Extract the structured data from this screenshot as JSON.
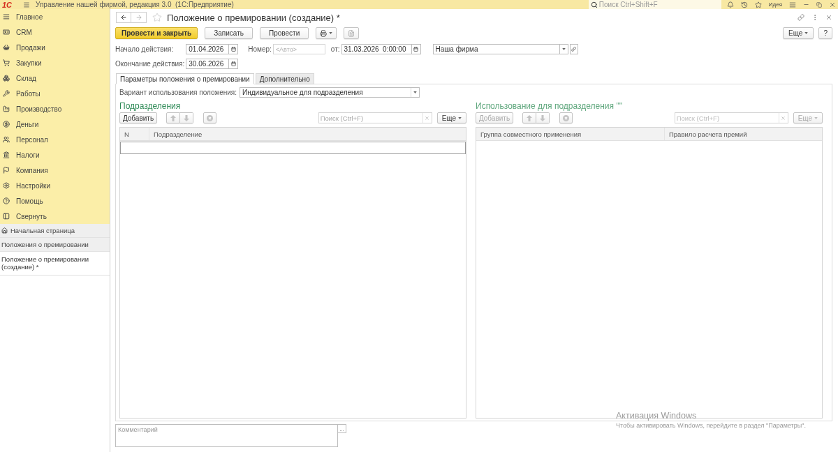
{
  "app_bar": {
    "logo": "1С",
    "title": "Управление нашей фирмой, редакция 3.0  (1С:Предприятие)",
    "search": {
      "placeholder": "Поиск Ctrl+Shift+F"
    },
    "idea": "Идея"
  },
  "sidebar": {
    "sections": [
      {
        "label": "Главное"
      },
      {
        "label": "CRM"
      },
      {
        "label": "Продажи"
      },
      {
        "label": "Закупки"
      },
      {
        "label": "Склад"
      },
      {
        "label": "Работы"
      },
      {
        "label": "Производство"
      },
      {
        "label": "Деньги"
      },
      {
        "label": "Персонал"
      },
      {
        "label": "Налоги"
      },
      {
        "label": "Компания"
      },
      {
        "label": "Настройки"
      },
      {
        "label": "Помощь"
      },
      {
        "label": "Свернуть"
      }
    ],
    "open_windows": [
      {
        "label": "Начальная страница",
        "kind": "home",
        "selected": false
      },
      {
        "label": "Положения о премировании",
        "kind": "window",
        "selected": false
      },
      {
        "label": "Положение о премировании (создание) *",
        "kind": "window",
        "selected": true
      }
    ]
  },
  "form": {
    "title": "Положение о премировании (создание) *",
    "starred": false,
    "toolbar": [
      {
        "kind": "primary",
        "label": "Провести и закрыть"
      },
      {
        "kind": "plain",
        "label": "Записать"
      },
      {
        "kind": "plain",
        "label": "Провести"
      },
      {
        "kind": "print"
      },
      {
        "kind": "report"
      }
    ],
    "more": "Еще",
    "help": "?",
    "start": {
      "label": "Начало действия:",
      "value": "01.04.2026"
    },
    "number": {
      "label": "Номер:",
      "placeholder": "<Авто>"
    },
    "date": {
      "label": "от:",
      "value": "31.03.2026  0:00:00"
    },
    "organization": {
      "value": "Наша фирма"
    },
    "end": {
      "label": "Окончание действия:",
      "value": "30.06.2026"
    },
    "tabs": [
      {
        "label": "Параметры положения о премировании",
        "selected": true
      },
      {
        "label": "Дополнительно",
        "selected": false
      }
    ],
    "usage_variant": {
      "label": "Вариант использования положения:",
      "value": "Индивидуальное для подразделения"
    },
    "panels": [
      {
        "title": "Подразделения",
        "disabled": false,
        "new_row": true,
        "add": "Добавить",
        "search": {
          "placeholder": "Поиск (Ctrl+F)"
        },
        "more": "Еще",
        "columns": [
          "N",
          "Подразделение"
        ]
      },
      {
        "title": "Использование для подразделения \"\"",
        "disabled": true,
        "new_row": false,
        "add": "Добавить",
        "search": {
          "placeholder": "Поиск (Ctrl+F)"
        },
        "more": "Еще",
        "columns": [
          "Группа совместного применения",
          "Правило расчета премий"
        ]
      }
    ],
    "comment": {
      "placeholder": "Комментарий",
      "button": "..."
    }
  },
  "windows_activation": {
    "title": "Активация Windows",
    "text": "Чтобы активировать Windows, перейдите в раздел \"Параметры\"."
  }
}
